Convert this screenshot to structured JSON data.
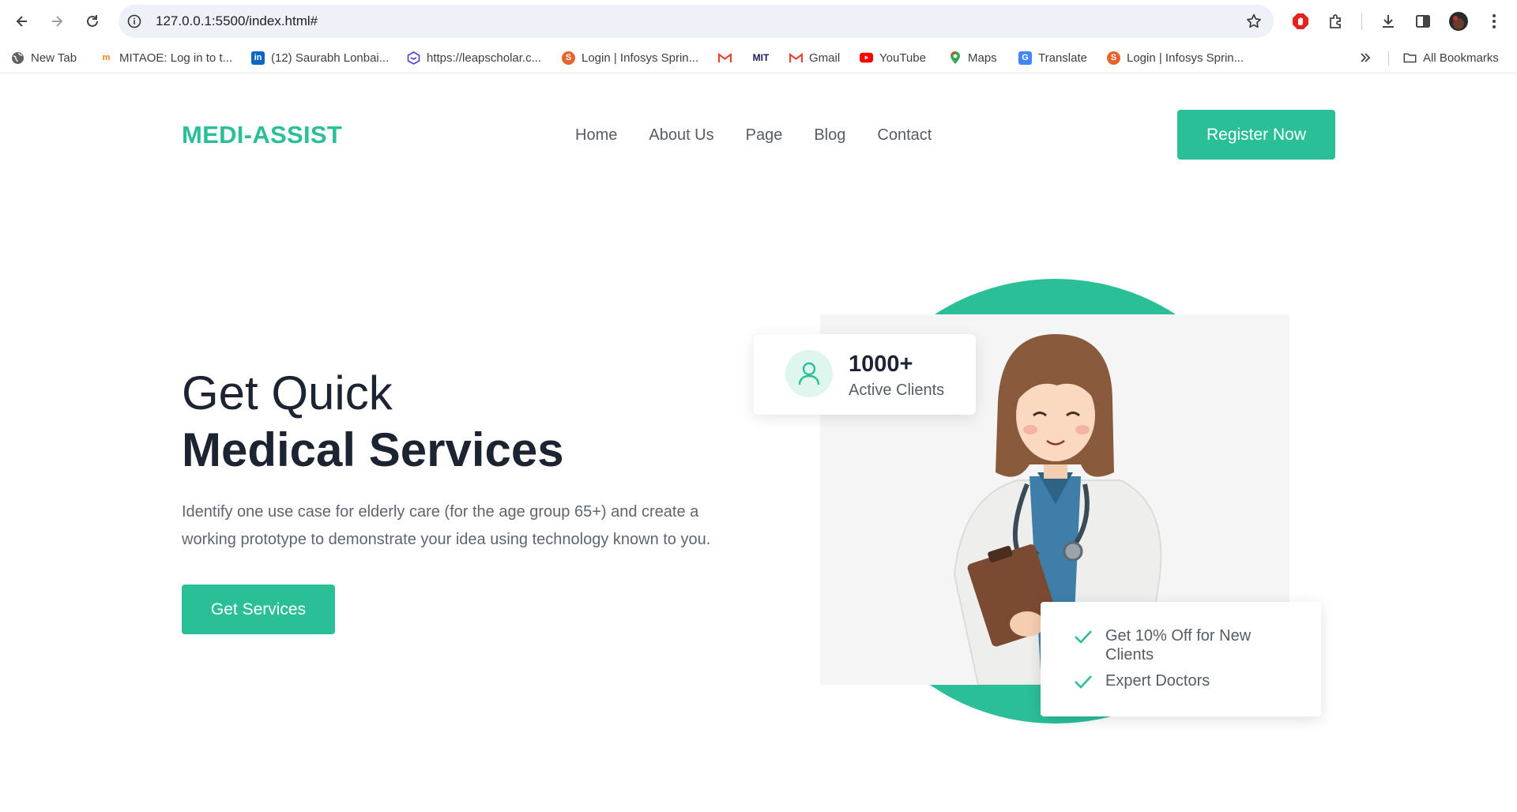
{
  "browser": {
    "url": "127.0.0.1:5500/index.html#",
    "bookmarks": [
      {
        "label": "New Tab",
        "icon": "globe-icon"
      },
      {
        "label": "MITAOE: Log in to t...",
        "icon": "moodle-icon"
      },
      {
        "label": "(12) Saurabh Lonbai...",
        "icon": "linkedin-icon"
      },
      {
        "label": "https://leapscholar.c...",
        "icon": "leapscholar-icon"
      },
      {
        "label": "Login | Infosys Sprin...",
        "icon": "infosys-icon"
      },
      {
        "label": "",
        "icon": "gmail-icon"
      },
      {
        "label": "",
        "icon": "mit-icon"
      },
      {
        "label": "Gmail",
        "icon": "gmail-icon"
      },
      {
        "label": "YouTube",
        "icon": "youtube-icon"
      },
      {
        "label": "Maps",
        "icon": "maps-icon"
      },
      {
        "label": "Translate",
        "icon": "translate-icon"
      },
      {
        "label": "Login | Infosys Sprin...",
        "icon": "infosys-icon"
      }
    ],
    "all_bookmarks": "All Bookmarks"
  },
  "site": {
    "logo": "MEDI-ASSIST",
    "nav": [
      "Home",
      "About Us",
      "Page",
      "Blog",
      "Contact"
    ],
    "register_label": "Register Now",
    "hero": {
      "title_line1": "Get Quick",
      "title_line2": "Medical Services",
      "description": "Identify one use case for elderly care (for the age group 65+) and create a working prototype to demonstrate your idea using technology known to you.",
      "cta_label": "Get Services"
    },
    "stats_card": {
      "number": "1000+",
      "label": "Active Clients"
    },
    "features": [
      "Get 10% Off for New Clients",
      "Expert Doctors"
    ]
  },
  "colors": {
    "accent": "#2bbf97",
    "heading": "#1c2331",
    "body_text": "#5d6670"
  }
}
